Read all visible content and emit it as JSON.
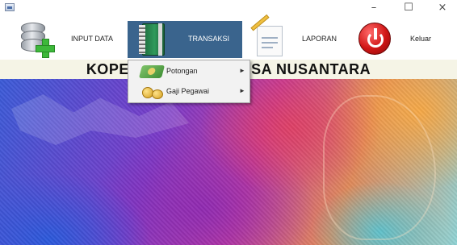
{
  "window": {
    "controls": {
      "minimize": "–",
      "maximize": "☐",
      "close": "×"
    }
  },
  "menubar": {
    "items": [
      {
        "label": "INPUT DATA",
        "icon": "database-add-icon"
      },
      {
        "label": "TRANSAKSI",
        "icon": "book-icon",
        "active": true
      },
      {
        "label": "LAPORAN",
        "icon": "report-icon"
      },
      {
        "label": "Keluar",
        "icon": "exit-power-icon"
      }
    ]
  },
  "banner": {
    "title": "KOPERASI PT. ANGKASA NUSANTARA",
    "visible_left": "KOPERA",
    "visible_right": "AKSA NUSANTARA"
  },
  "dropdown": {
    "items": [
      {
        "label": "Potongan",
        "icon": "money-icon",
        "submenu_arrow": "►"
      },
      {
        "label": "Gaji Pegawai",
        "icon": "coins-icon",
        "submenu_arrow": "►"
      }
    ]
  },
  "colors": {
    "menu_active_bg": "#3a648d",
    "banner_bg": "#f5f4e6"
  }
}
